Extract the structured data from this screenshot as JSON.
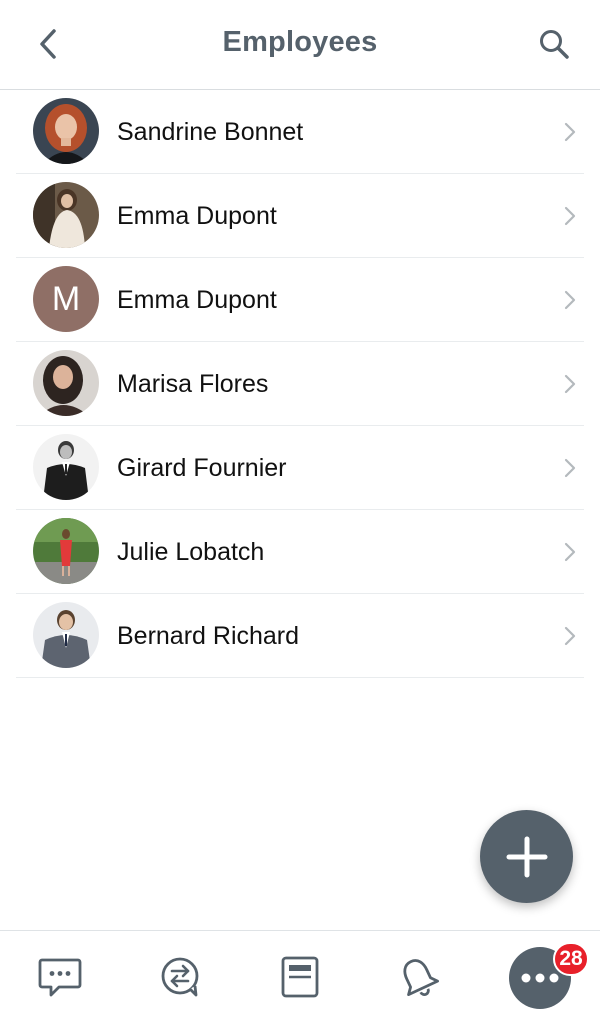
{
  "header": {
    "title": "Employees",
    "back_icon": "chevron-left-icon",
    "search_icon": "search-icon"
  },
  "employees": [
    {
      "name": "Sandrine Bonnet",
      "avatar": "photo"
    },
    {
      "name": "Emma Dupont",
      "avatar": "photo"
    },
    {
      "name": "Emma Dupont",
      "avatar": "initial",
      "initial": "M",
      "avatar_color": "#8f6f66"
    },
    {
      "name": "Marisa Flores",
      "avatar": "photo"
    },
    {
      "name": "Girard Fournier",
      "avatar": "photo"
    },
    {
      "name": "Julie Lobatch",
      "avatar": "photo"
    },
    {
      "name": "Bernard Richard",
      "avatar": "photo"
    }
  ],
  "fab": {
    "icon": "plus-icon"
  },
  "tabbar": {
    "tabs": [
      {
        "icon": "chat-bubble-icon"
      },
      {
        "icon": "conversation-swap-icon"
      },
      {
        "icon": "document-icon"
      },
      {
        "icon": "bell-icon"
      },
      {
        "icon": "more-dots-icon"
      }
    ],
    "badge_count": "28"
  },
  "colors": {
    "primary": "#55616b",
    "badge": "#e8202a",
    "divider": "#e9ecee"
  }
}
